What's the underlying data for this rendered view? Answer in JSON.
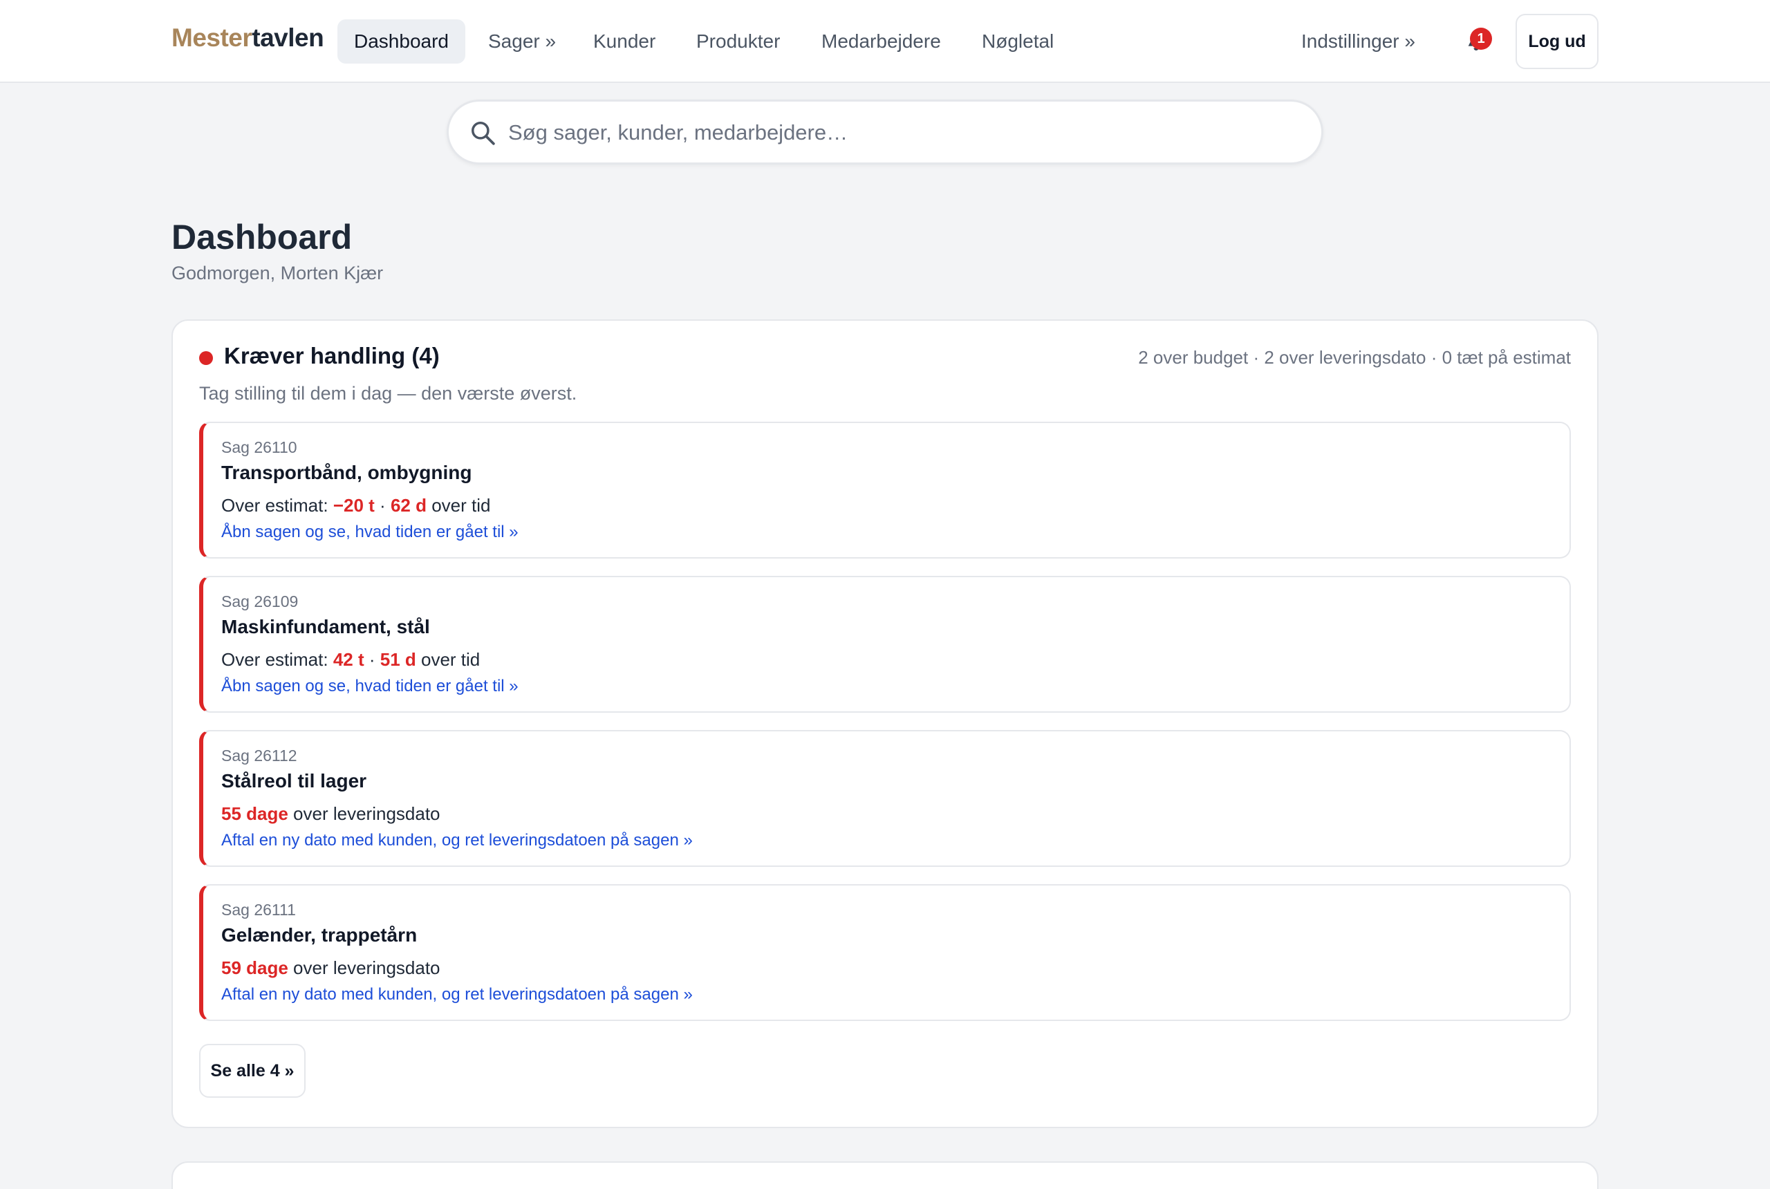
{
  "header": {
    "brand_part1": "Mester",
    "brand_part2": "tavlen",
    "nav": [
      {
        "label": "Dashboard",
        "active": true
      },
      {
        "label": "Sager »"
      },
      {
        "label": "Kunder"
      },
      {
        "label": "Produkter"
      },
      {
        "label": "Medarbejdere"
      },
      {
        "label": "Nøgletal"
      }
    ],
    "settings_label": "Indstillinger »",
    "notification_count": "1",
    "logout_label": "Log ud"
  },
  "search": {
    "placeholder": "Søg sager, kunder, medarbejdere…",
    "value": ""
  },
  "page": {
    "title": "Dashboard",
    "greeting": "Godmorgen, Morten Kjær"
  },
  "action_panel": {
    "title": "Kræver handling (4)",
    "stats": "2 over budget · 2 over leveringsdato · 0 tæt på estimat",
    "description": "Tag stilling til dem i dag — den værste øverst.",
    "see_all_label": "Se alle 4 »",
    "items": [
      {
        "case_no": "Sag 26110",
        "title": "Transportbånd, ombygning",
        "prefix": "Over estimat: ",
        "hours": "−20 t",
        "sep": " · ",
        "days": "62 d",
        "suffix": " over tid",
        "link": "Åbn sagen og se, hvad tiden er gået til »"
      },
      {
        "case_no": "Sag 26109",
        "title": "Maskinfundament, stål",
        "prefix": "Over estimat: ",
        "hours": "42 t",
        "sep": " · ",
        "days": "51 d",
        "suffix": " over tid",
        "link": "Åbn sagen og se, hvad tiden er gået til »"
      },
      {
        "case_no": "Sag 26112",
        "title": "Stålreol til lager",
        "days": "55 dage",
        "suffix": " over leveringsdato",
        "link": "Aftal en ny dato med kunden, og ret leveringsdatoen på sagen »"
      },
      {
        "case_no": "Sag 26111",
        "title": "Gelænder, trappetårn",
        "days": "59 dage",
        "suffix": " over leveringsdato",
        "link": "Aftal en ny dato med kunden, og ret leveringsdatoen på sagen »"
      }
    ]
  },
  "colors": {
    "brand_gold": "#a8855a",
    "alert_red": "#dc2626",
    "link_blue": "#1d4ed8"
  }
}
